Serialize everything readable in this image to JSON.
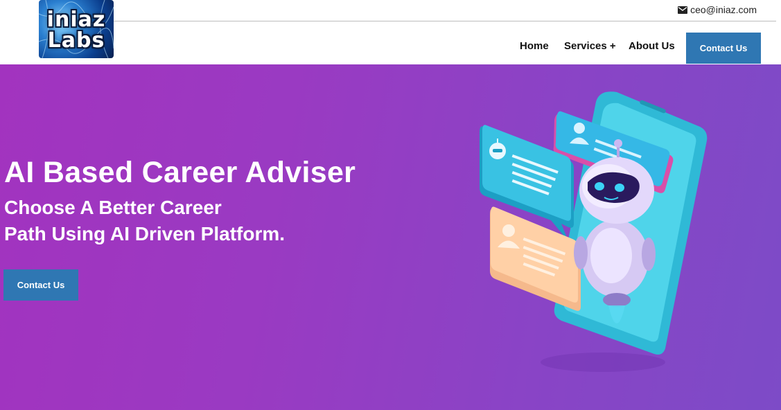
{
  "header": {
    "logo": {
      "line1": "iniaz",
      "line2": "Labs"
    },
    "email": "ceo@iniaz.com",
    "nav": {
      "home": "Home",
      "services": "Services +",
      "about": "About Us",
      "contact": "Contact Us"
    }
  },
  "hero": {
    "title": "AI Based Career Adviser",
    "subtitle_line1": "Choose A Better Career",
    "subtitle_line2": "Path Using AI Driven Platform.",
    "cta": "Contact Us"
  },
  "colors": {
    "primary_button": "#2f77b3",
    "hero_gradient_start": "#a233bf",
    "hero_gradient_end": "#7d4bc7"
  },
  "icons": [
    "envelope-icon",
    "robot-icon",
    "user-icon",
    "smartphone-icon"
  ]
}
